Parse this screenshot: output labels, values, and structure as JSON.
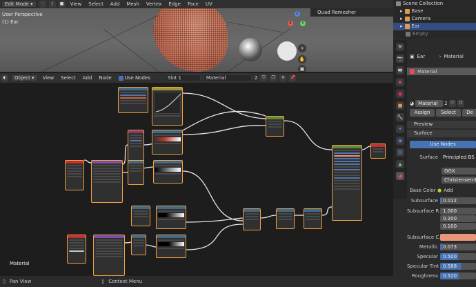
{
  "viewport": {
    "mode": "Edit Mode",
    "menus": [
      "View",
      "Select",
      "Add",
      "Mesh",
      "Vertex",
      "Edge",
      "Face",
      "UV"
    ],
    "perspective": "User Perspective",
    "object_label": "(1) Ear",
    "remesher_panel": "Quad Remesher",
    "axes": {
      "x": "X",
      "y": "Y",
      "z": "Z"
    }
  },
  "node_editor": {
    "type": "Object",
    "menus": [
      "View",
      "Select",
      "Add",
      "Node"
    ],
    "use_nodes_label": "Use Nodes",
    "slot": "Slot 1",
    "material_name": "Material",
    "user_count": "2",
    "canvas_label": "Material"
  },
  "statusbar": {
    "pan": "Pan View",
    "context": "Context Menu"
  },
  "outliner": {
    "title": "Scene Collection",
    "items": [
      "Base",
      "Camera",
      "Ear",
      "Empty"
    ]
  },
  "properties": {
    "object_name": "Ear",
    "material_tab": "Material",
    "slot_name": "Material",
    "material_datablock": "Material",
    "datablock_users": "2",
    "assign": "Assign",
    "select": "Select",
    "deselect": "De",
    "preview": "Preview",
    "surface_section": "Surface",
    "use_nodes": "Use Nodes",
    "surface_label": "Surface",
    "surface_value": "Principled BS",
    "distribution": "GGX",
    "subsurface_method": "Christensen-Bur",
    "base_color_label": "Base Color",
    "base_color_value": "Add",
    "subsurface_label": "Subsurface",
    "subsurface_value": "0.012",
    "subsurface_radius_label": "Subsurface R...",
    "subsurface_radius": [
      "1.000",
      "0.200",
      "0.100"
    ],
    "subsurface_color_label": "Subsurface C...",
    "metallic_label": "Metallic",
    "metallic": "0.073",
    "specular_label": "Specular",
    "specular": "0.500",
    "specular_tint_label": "Specular Tint",
    "specular_tint": "0.588",
    "roughness_label": "Roughness",
    "roughness": "0.520"
  },
  "colors": {
    "accent": "#4772b3",
    "selected_node": "#f0a040",
    "subsurface_color": "#e8957a",
    "base_color_dot": "#c8c832"
  }
}
